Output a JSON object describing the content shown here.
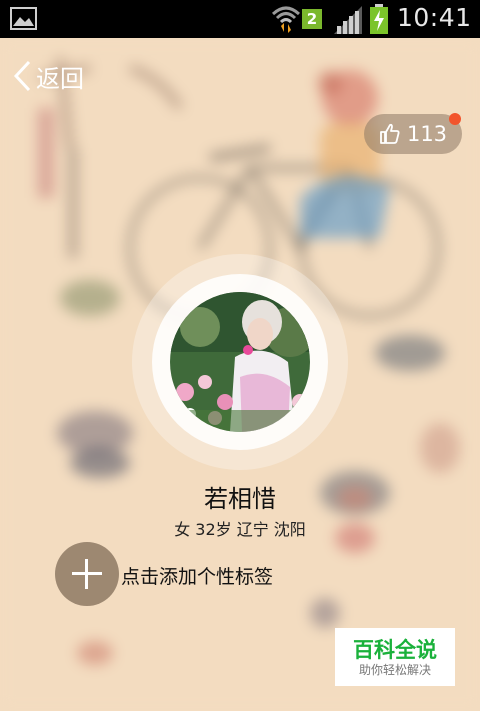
{
  "status_bar": {
    "time": "10:41",
    "sim_number": "2",
    "icons": [
      "gallery-icon",
      "wifi-icon",
      "signal-icon",
      "battery-charging-icon"
    ]
  },
  "nav": {
    "back_label": "返回",
    "like_count": "113"
  },
  "profile": {
    "name": "若相惜",
    "info": "女 32岁 辽宁 沈阳"
  },
  "tags": {
    "add_label": "点击添加个性标签"
  },
  "watermark": {
    "title": "百科全说",
    "subtitle": "助你轻松解决"
  },
  "colors": {
    "background": "#f3dcc0",
    "like_dot": "#f2542c",
    "watermark_green": "#1ab13b"
  }
}
